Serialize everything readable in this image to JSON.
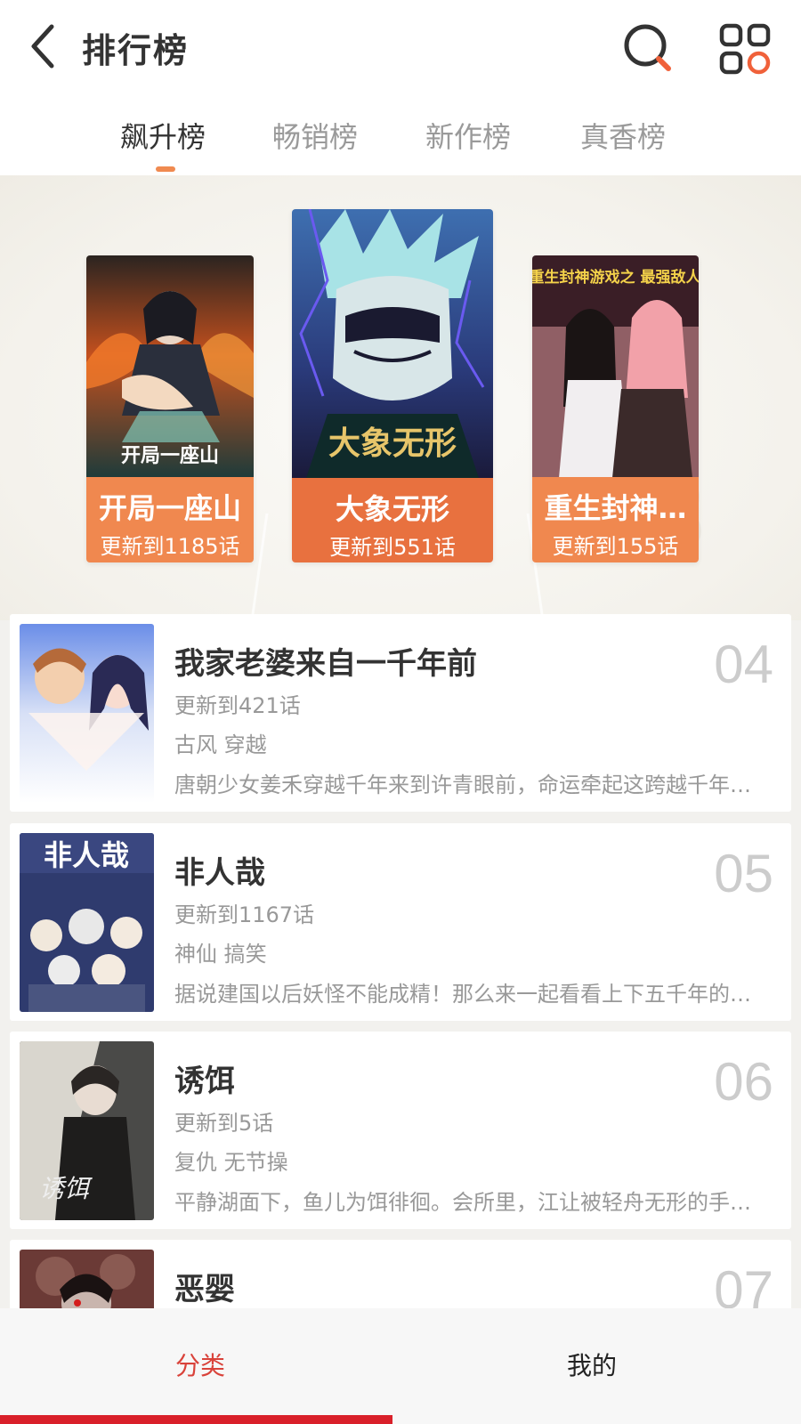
{
  "header": {
    "title": "排行榜"
  },
  "tabs": [
    {
      "label": "飙升榜",
      "active": true
    },
    {
      "label": "畅销榜",
      "active": false
    },
    {
      "label": "新作榜",
      "active": false
    },
    {
      "label": "真香榜",
      "active": false
    }
  ],
  "podium": [
    {
      "rank": "2",
      "title": "开局一座山",
      "update": "更新到1185话",
      "cover_text": "开局一座山"
    },
    {
      "rank": "1",
      "title": "大象无形",
      "update": "更新到551话",
      "cover_text": "大象无形"
    },
    {
      "rank": "3",
      "title": "重生封神…",
      "update": "更新到155话",
      "cover_text": "重生封神游戏之 最强敌人"
    }
  ],
  "list": [
    {
      "rank": "04",
      "title": "我家老婆来自一千年前",
      "update": "更新到421话",
      "tags": "古风 穿越",
      "desc": "唐朝少女姜禾穿越千年来到许青眼前，命运牵起这跨越千年的缘分"
    },
    {
      "rank": "05",
      "title": "非人哉",
      "update": "更新到1167话",
      "tags": "神仙 搞笑",
      "desc": "据说建国以后妖怪不能成精！那么来一起看看上下五千年的神仙妖怪们",
      "cover_text": "非人哉"
    },
    {
      "rank": "06",
      "title": "诱饵",
      "update": "更新到5话",
      "tags": "复仇 无节操",
      "desc": "平静湖面下，鱼儿为饵徘徊。会所里，江让被轻舟无形的手推入漩涡",
      "cover_text": "诱饵"
    },
    {
      "rank": "07",
      "title": "恶婴",
      "update": "",
      "tags": "",
      "desc": ""
    }
  ],
  "bottom_nav": {
    "category": "分类",
    "mine": "我的"
  },
  "colors": {
    "accent": "#f08a50",
    "podium_bar": "#e8713f",
    "nav_active": "#d9423a"
  }
}
